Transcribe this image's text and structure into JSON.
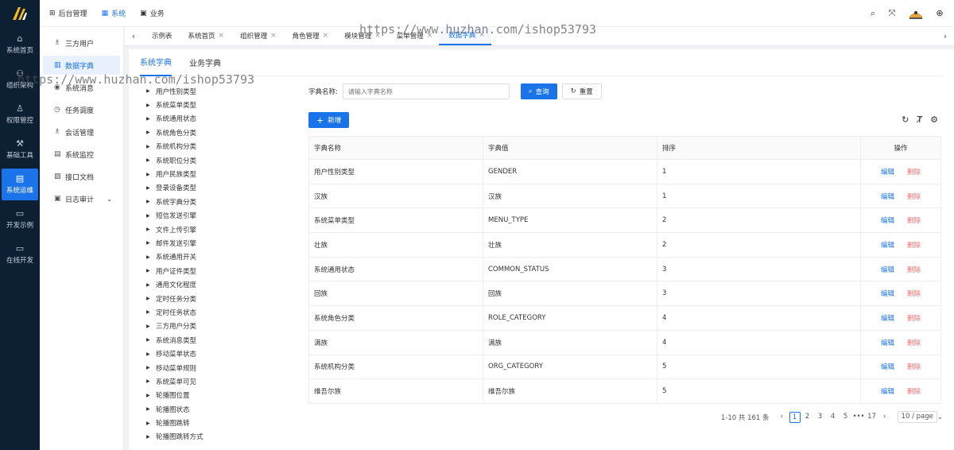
{
  "leftnav": {
    "items": [
      {
        "icon": "⌂",
        "label": "系统首页",
        "active": false
      },
      {
        "icon": "⚇",
        "label": "组织架构",
        "active": false
      },
      {
        "icon": "♙",
        "label": "权限管控",
        "active": false
      },
      {
        "icon": "⚒",
        "label": "基础工具",
        "active": false
      },
      {
        "icon": "▤",
        "label": "系统运维",
        "active": true
      },
      {
        "icon": "▭",
        "label": "开发示例",
        "active": false
      },
      {
        "icon": "▭",
        "label": "在线开发",
        "active": false
      }
    ]
  },
  "topbar": {
    "menus": [
      {
        "icon": "⊞",
        "label": "后台管理",
        "active": false
      },
      {
        "icon": "▦",
        "label": "系统",
        "active": true
      },
      {
        "icon": "▣",
        "label": "业务",
        "active": false
      }
    ],
    "icons": [
      "search-icon",
      "fullscreen-icon",
      "avatar",
      "language-icon"
    ]
  },
  "sidebar": {
    "items": [
      {
        "icon": "♗",
        "label": "三方用户",
        "active": false
      },
      {
        "icon": "▥",
        "label": "数据字典",
        "active": true
      },
      {
        "icon": "◉",
        "label": "系统消息",
        "active": false
      },
      {
        "icon": "◷",
        "label": "任务调度",
        "active": false
      },
      {
        "icon": "♗",
        "label": "会话管理",
        "active": false
      },
      {
        "icon": "▤",
        "label": "系统监控",
        "active": false
      },
      {
        "icon": "▨",
        "label": "接口文档",
        "active": false
      },
      {
        "icon": "▣",
        "label": "日志审计",
        "active": false
      }
    ]
  },
  "tabs": {
    "items": [
      {
        "label": "示例表",
        "closable": false,
        "active": false
      },
      {
        "label": "系统首页",
        "closable": true,
        "active": false
      },
      {
        "label": "组织管理",
        "closable": true,
        "active": false
      },
      {
        "label": "角色管理",
        "closable": true,
        "active": false
      },
      {
        "label": "模块管理",
        "closable": true,
        "active": false
      },
      {
        "label": "菜单管理",
        "closable": true,
        "active": false
      },
      {
        "label": "数据字典",
        "closable": true,
        "active": true
      }
    ]
  },
  "subtabs": [
    "系统字典",
    "业务字典"
  ],
  "tree": [
    "用户性别类型",
    "系统菜单类型",
    "系统通用状态",
    "系统角色分类",
    "系统机构分类",
    "系统职位分类",
    "用户民族类型",
    "登录设备类型",
    "系统字典分类",
    "短信发送引擎",
    "文件上传引擎",
    "邮件发送引擎",
    "系统通用开关",
    "用户证件类型",
    "通用文化程度",
    "定时任务分类",
    "定时任务状态",
    "三方用户分类",
    "系统消息类型",
    "移动菜单状态",
    "移动菜单规则",
    "系统菜单可见",
    "轮播图位置",
    "轮播图状态",
    "轮播图跳转",
    "轮播图跳转方式"
  ],
  "search": {
    "label": "字典名称:",
    "placeholder": "请输入字典名称",
    "query_label": "查询",
    "reset_label": "重置"
  },
  "toolbar": {
    "add_label": "新增"
  },
  "table": {
    "headers": [
      "字典名称",
      "字典值",
      "排序",
      "操作"
    ],
    "rows": [
      {
        "name": "用户性别类型",
        "value": "GENDER",
        "sort": "1"
      },
      {
        "name": "汉族",
        "value": "汉族",
        "sort": "1"
      },
      {
        "name": "系统菜单类型",
        "value": "MENU_TYPE",
        "sort": "2"
      },
      {
        "name": "壮族",
        "value": "壮族",
        "sort": "2"
      },
      {
        "name": "系统通用状态",
        "value": "COMMON_STATUS",
        "sort": "3"
      },
      {
        "name": "回族",
        "value": "回族",
        "sort": "3"
      },
      {
        "name": "系统角色分类",
        "value": "ROLE_CATEGORY",
        "sort": "4"
      },
      {
        "name": "满族",
        "value": "满族",
        "sort": "4"
      },
      {
        "name": "系统机构分类",
        "value": "ORG_CATEGORY",
        "sort": "5"
      },
      {
        "name": "维吾尔族",
        "value": "维吾尔族",
        "sort": "5"
      }
    ],
    "edit_label": "编辑",
    "delete_label": "删除"
  },
  "pagination": {
    "total_text": "1-10 共 161 条",
    "pages": [
      "1",
      "2",
      "3",
      "4",
      "5",
      "•••",
      "17"
    ],
    "current": "1",
    "page_size": "10 / page"
  },
  "watermark": "https://www.huzhan.com/ishop53793",
  "colors": {
    "primary": "#1a73e8",
    "danger": "#f56c6c",
    "sidebar_bg": "#0d1f33"
  }
}
